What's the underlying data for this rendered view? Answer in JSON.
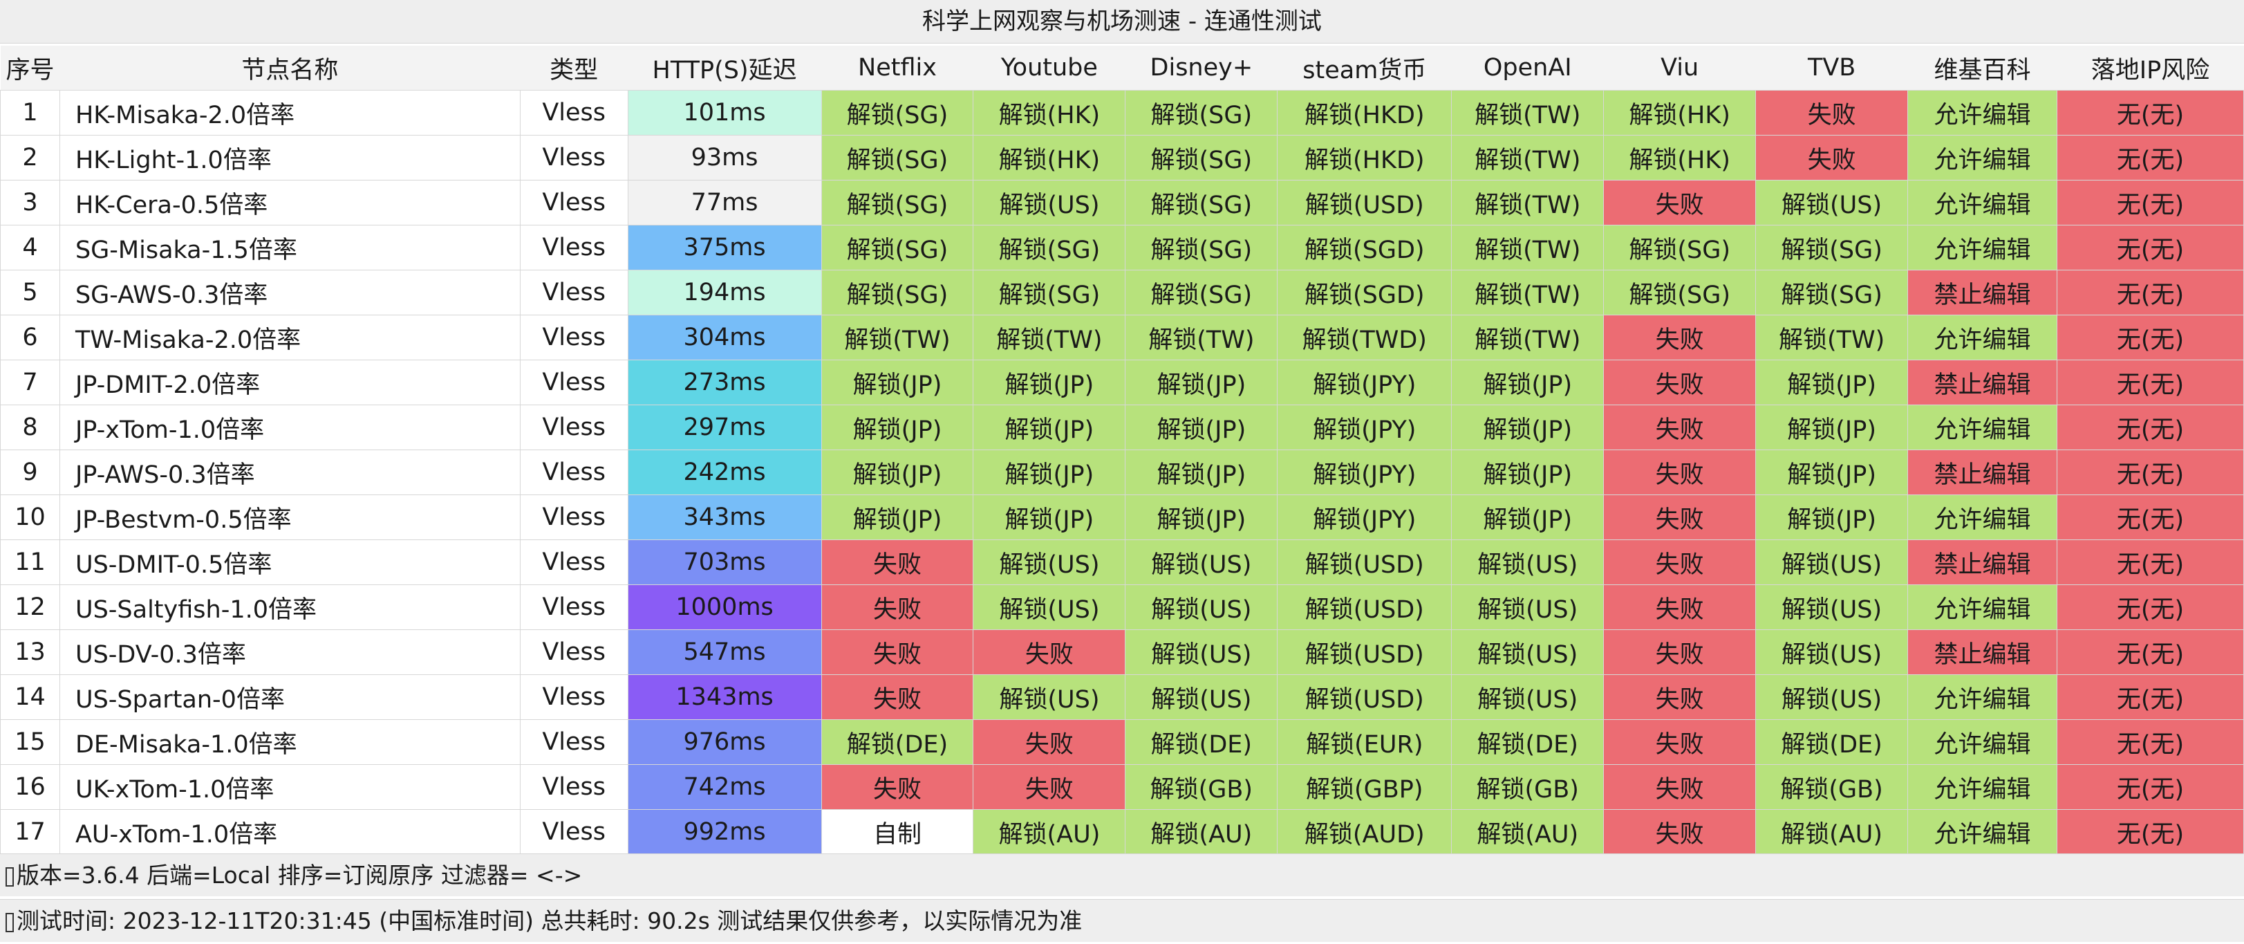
{
  "title": "科学上网观察与机场测速 - 连通性测试",
  "colors": {
    "ok": "#b7e27c",
    "fail": "#ec6c73",
    "self": "#ffffff",
    "risk": "#ec6c73",
    "header_bg": "#f3f3f3"
  },
  "headers": [
    "序号",
    "节点名称",
    "类型",
    "HTTP(S)延迟",
    "Netflix",
    "Youtube",
    "Disney+",
    "steam货币",
    "OpenAI",
    "Viu",
    "TVB",
    "维基百科",
    "落地IP风险"
  ],
  "rows": [
    {
      "idx": "1",
      "name": "HK-Misaka-2.0倍率",
      "type": "Vless",
      "delay": "101ms",
      "delay_color": "#c6f7e4",
      "tests": [
        "解锁(SG)",
        "解锁(HK)",
        "解锁(SG)",
        "解锁(HKD)",
        "解锁(TW)",
        "解锁(HK)",
        "失败",
        "允许编辑",
        "无(无)"
      ]
    },
    {
      "idx": "2",
      "name": "HK-Light-1.0倍率",
      "type": "Vless",
      "delay": "93ms",
      "delay_color": "#f2f2f2",
      "tests": [
        "解锁(SG)",
        "解锁(HK)",
        "解锁(SG)",
        "解锁(HKD)",
        "解锁(TW)",
        "解锁(HK)",
        "失败",
        "允许编辑",
        "无(无)"
      ]
    },
    {
      "idx": "3",
      "name": "HK-Cera-0.5倍率",
      "type": "Vless",
      "delay": "77ms",
      "delay_color": "#f2f2f2",
      "tests": [
        "解锁(SG)",
        "解锁(US)",
        "解锁(SG)",
        "解锁(USD)",
        "解锁(TW)",
        "失败",
        "解锁(US)",
        "允许编辑",
        "无(无)"
      ]
    },
    {
      "idx": "4",
      "name": "SG-Misaka-1.5倍率",
      "type": "Vless",
      "delay": "375ms",
      "delay_color": "#77bdf8",
      "tests": [
        "解锁(SG)",
        "解锁(SG)",
        "解锁(SG)",
        "解锁(SGD)",
        "解锁(TW)",
        "解锁(SG)",
        "解锁(SG)",
        "允许编辑",
        "无(无)"
      ]
    },
    {
      "idx": "5",
      "name": "SG-AWS-0.3倍率",
      "type": "Vless",
      "delay": "194ms",
      "delay_color": "#c6f7e4",
      "tests": [
        "解锁(SG)",
        "解锁(SG)",
        "解锁(SG)",
        "解锁(SGD)",
        "解锁(TW)",
        "解锁(SG)",
        "解锁(SG)",
        "禁止编辑",
        "无(无)"
      ]
    },
    {
      "idx": "6",
      "name": "TW-Misaka-2.0倍率",
      "type": "Vless",
      "delay": "304ms",
      "delay_color": "#77bdf8",
      "tests": [
        "解锁(TW)",
        "解锁(TW)",
        "解锁(TW)",
        "解锁(TWD)",
        "解锁(TW)",
        "失败",
        "解锁(TW)",
        "允许编辑",
        "无(无)"
      ]
    },
    {
      "idx": "7",
      "name": "JP-DMIT-2.0倍率",
      "type": "Vless",
      "delay": "273ms",
      "delay_color": "#5fd5e5",
      "tests": [
        "解锁(JP)",
        "解锁(JP)",
        "解锁(JP)",
        "解锁(JPY)",
        "解锁(JP)",
        "失败",
        "解锁(JP)",
        "禁止编辑",
        "无(无)"
      ]
    },
    {
      "idx": "8",
      "name": "JP-xTom-1.0倍率",
      "type": "Vless",
      "delay": "297ms",
      "delay_color": "#5fd5e5",
      "tests": [
        "解锁(JP)",
        "解锁(JP)",
        "解锁(JP)",
        "解锁(JPY)",
        "解锁(JP)",
        "失败",
        "解锁(JP)",
        "允许编辑",
        "无(无)"
      ]
    },
    {
      "idx": "9",
      "name": "JP-AWS-0.3倍率",
      "type": "Vless",
      "delay": "242ms",
      "delay_color": "#5fd5e5",
      "tests": [
        "解锁(JP)",
        "解锁(JP)",
        "解锁(JP)",
        "解锁(JPY)",
        "解锁(JP)",
        "失败",
        "解锁(JP)",
        "禁止编辑",
        "无(无)"
      ]
    },
    {
      "idx": "10",
      "name": "JP-Bestvm-0.5倍率",
      "type": "Vless",
      "delay": "343ms",
      "delay_color": "#77bdf8",
      "tests": [
        "解锁(JP)",
        "解锁(JP)",
        "解锁(JP)",
        "解锁(JPY)",
        "解锁(JP)",
        "失败",
        "解锁(JP)",
        "允许编辑",
        "无(无)"
      ]
    },
    {
      "idx": "11",
      "name": "US-DMIT-0.5倍率",
      "type": "Vless",
      "delay": "703ms",
      "delay_color": "#7b8ff5",
      "tests": [
        "失败",
        "解锁(US)",
        "解锁(US)",
        "解锁(USD)",
        "解锁(US)",
        "失败",
        "解锁(US)",
        "禁止编辑",
        "无(无)"
      ]
    },
    {
      "idx": "12",
      "name": "US-Saltyfish-1.0倍率",
      "type": "Vless",
      "delay": "1000ms",
      "delay_color": "#8a5cf5",
      "tests": [
        "失败",
        "解锁(US)",
        "解锁(US)",
        "解锁(USD)",
        "解锁(US)",
        "失败",
        "解锁(US)",
        "允许编辑",
        "无(无)"
      ]
    },
    {
      "idx": "13",
      "name": "US-DV-0.3倍率",
      "type": "Vless",
      "delay": "547ms",
      "delay_color": "#7b8ff5",
      "tests": [
        "失败",
        "失败",
        "解锁(US)",
        "解锁(USD)",
        "解锁(US)",
        "失败",
        "解锁(US)",
        "禁止编辑",
        "无(无)"
      ]
    },
    {
      "idx": "14",
      "name": "US-Spartan-0倍率",
      "type": "Vless",
      "delay": "1343ms",
      "delay_color": "#8a5cf5",
      "tests": [
        "失败",
        "解锁(US)",
        "解锁(US)",
        "解锁(USD)",
        "解锁(US)",
        "失败",
        "解锁(US)",
        "允许编辑",
        "无(无)"
      ]
    },
    {
      "idx": "15",
      "name": "DE-Misaka-1.0倍率",
      "type": "Vless",
      "delay": "976ms",
      "delay_color": "#7b8ff5",
      "tests": [
        "解锁(DE)",
        "失败",
        "解锁(DE)",
        "解锁(EUR)",
        "解锁(DE)",
        "失败",
        "解锁(DE)",
        "允许编辑",
        "无(无)"
      ]
    },
    {
      "idx": "16",
      "name": "UK-xTom-1.0倍率",
      "type": "Vless",
      "delay": "742ms",
      "delay_color": "#7b8ff5",
      "tests": [
        "失败",
        "失败",
        "解锁(GB)",
        "解锁(GBP)",
        "解锁(GB)",
        "失败",
        "解锁(GB)",
        "允许编辑",
        "无(无)"
      ]
    },
    {
      "idx": "17",
      "name": "AU-xTom-1.0倍率",
      "type": "Vless",
      "delay": "992ms",
      "delay_color": "#7b8ff5",
      "tests": [
        "自制",
        "解锁(AU)",
        "解锁(AU)",
        "解锁(AUD)",
        "解锁(AU)",
        "失败",
        "解锁(AU)",
        "允许编辑",
        "无(无)"
      ]
    }
  ],
  "footer": {
    "line1": "版本=3.6.4  后端=Local  排序=订阅原序  过滤器= <->",
    "line2": "测试时间: 2023-12-11T20:31:45 (中国标准时间) 总共耗时: 90.2s 测试结果仅供参考，以实际情况为准"
  }
}
